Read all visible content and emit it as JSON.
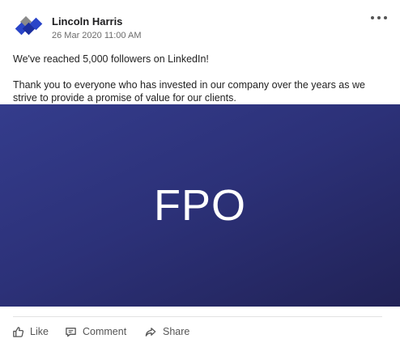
{
  "post": {
    "author": "Lincoln Harris",
    "timestamp": "26 Mar 2020 11:00 AM",
    "logo_icon": "blue-diamonds-logo-icon",
    "more_icon": "ellipsis-icon",
    "text_line1": "We've reached 5,000 followers on LinkedIn!",
    "text_line2": "Thank you to everyone who has invested in our company over the years as we strive to provide a promise of value for our clients.",
    "media_label": "FPO"
  },
  "actions": {
    "like": {
      "label": "Like",
      "icon": "thumbs-up-icon"
    },
    "comment": {
      "label": "Comment",
      "icon": "comment-icon"
    },
    "share": {
      "label": "Share",
      "icon": "share-arrow-icon"
    }
  },
  "colors": {
    "brand_blue": "#2a45c8",
    "logo_gray": "#8a8a8a",
    "media_background": "#2c3178",
    "media_text": "#ffffff",
    "action_text": "#555555"
  }
}
